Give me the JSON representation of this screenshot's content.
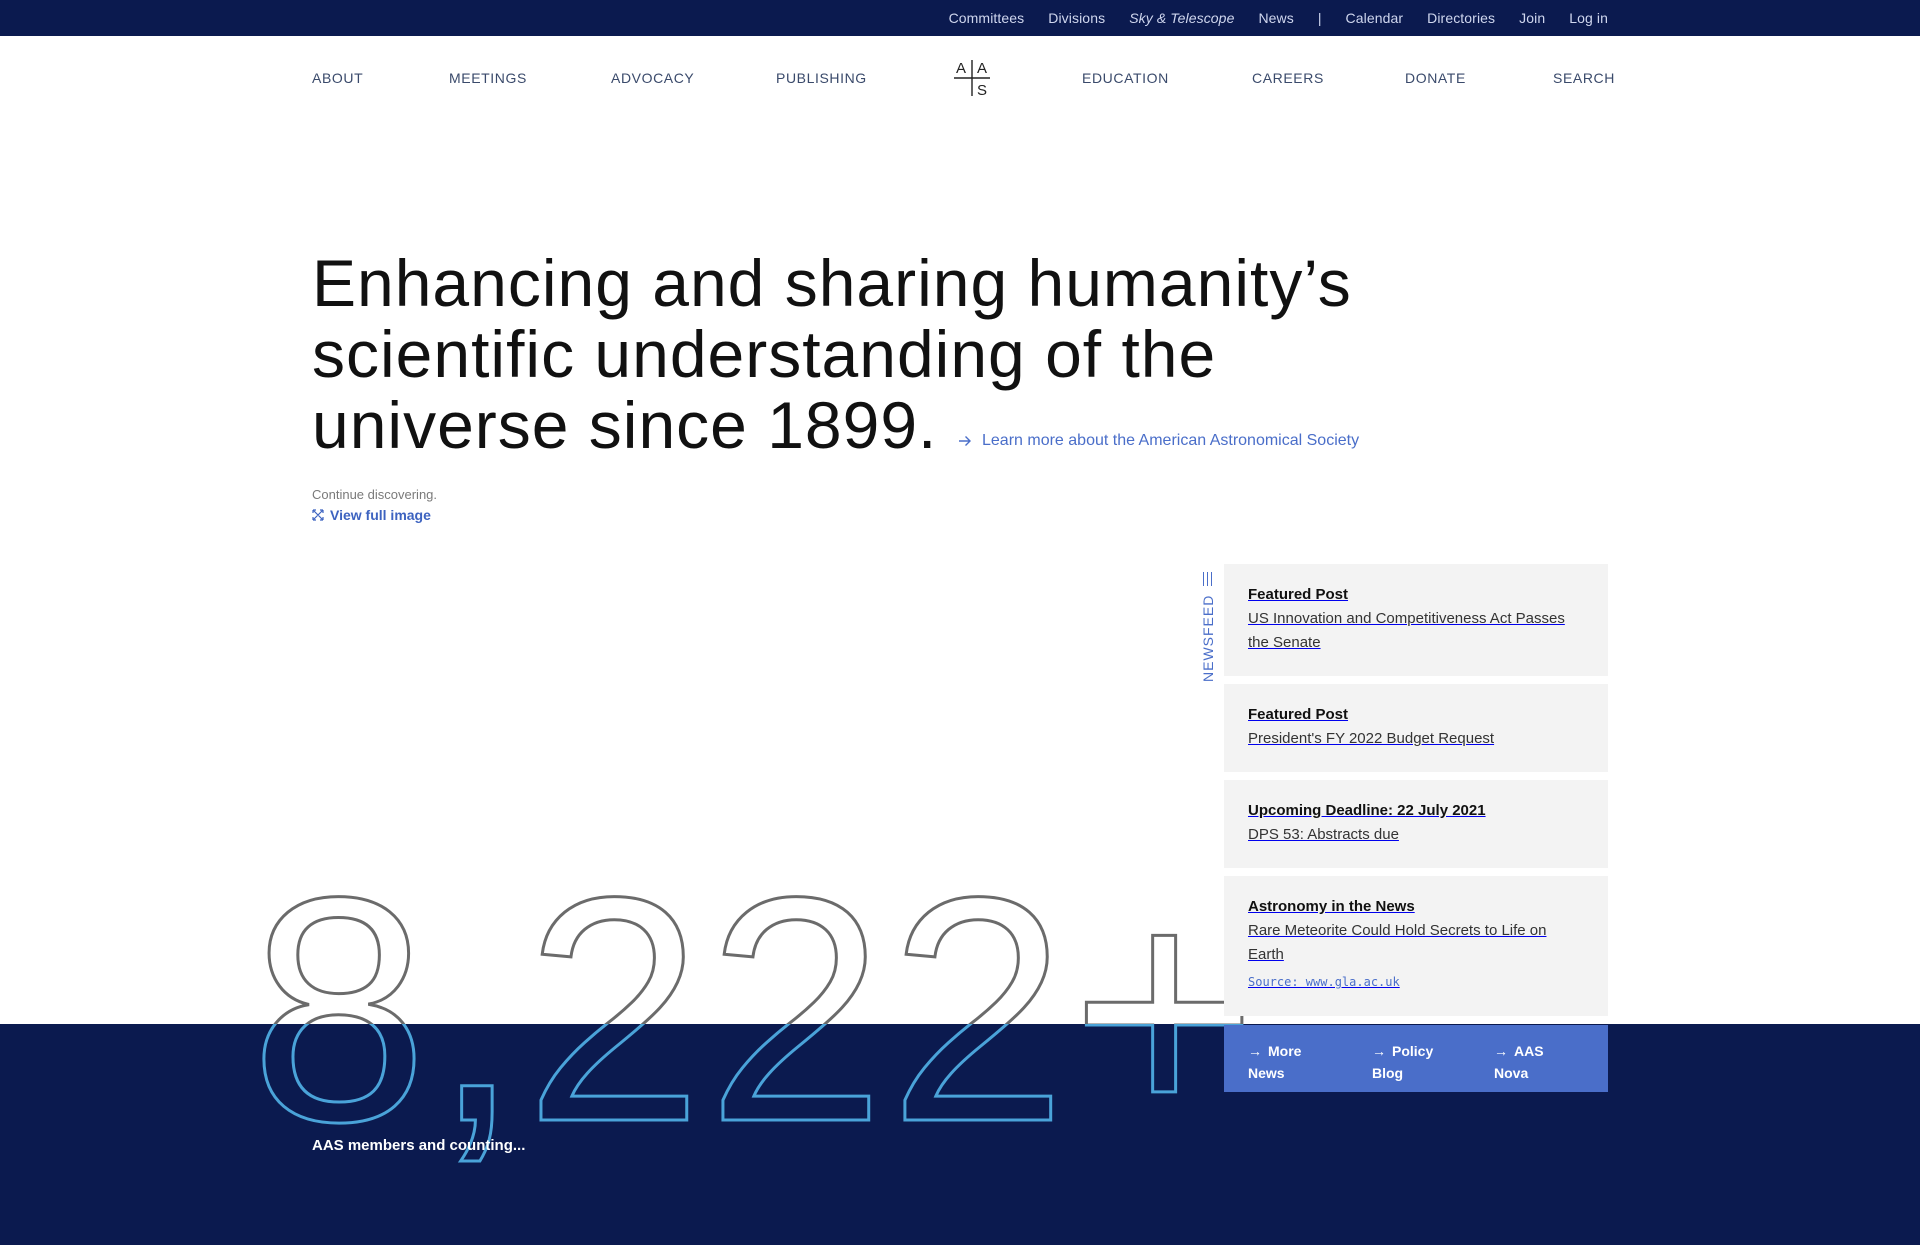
{
  "utility_nav": {
    "items": [
      "Committees",
      "Divisions",
      "Sky & Telescope",
      "News",
      "|",
      "Calendar",
      "Directories",
      "Join",
      "Log in"
    ]
  },
  "main_nav": {
    "about": "ABOUT",
    "meetings": "MEETINGS",
    "advocacy": "ADVOCACY",
    "publishing": "PUBLISHING",
    "education": "EDUCATION",
    "careers": "CAREERS",
    "donate": "DONATE",
    "search": "SEARCH",
    "logo_letters": [
      "A",
      "A",
      "S"
    ]
  },
  "hero": {
    "title_line1": "Enhancing and sharing humanity’s",
    "title_line2": "scientific understanding of the",
    "title_line3": "universe since 1899.",
    "learn_more": "Learn more about the American Astronomical Society",
    "continue": "Continue discovering.",
    "view_full": "View full image"
  },
  "counter": {
    "value": "8,222+",
    "caption": "AAS members and counting..."
  },
  "newsfeed": {
    "label": "NEWSFEED",
    "cards": [
      {
        "label": "Featured Post",
        "body": "US Innovation and Competitiveness Act Passes the Senate"
      },
      {
        "label": "Featured Post",
        "body": "President's FY 2022 Budget Request"
      },
      {
        "label": "Upcoming Deadline: 22 July 2021",
        "body": "DPS 53: Abstracts due"
      },
      {
        "label": "Astronomy in the News",
        "body": "Rare Meteorite Could Hold Secrets to Life on Earth",
        "source": "Source: www.gla.ac.uk"
      }
    ],
    "links": [
      {
        "line1": "More",
        "line2": "News"
      },
      {
        "line1": "Policy",
        "line2": "Blog"
      },
      {
        "line1": "AAS",
        "line2": "Nova"
      }
    ]
  },
  "colors": {
    "navy": "#0b1a4f",
    "accent_blue": "#4a6ec9",
    "outline_light": "#4aa3d9",
    "outline_gray": "#6b6b6b"
  }
}
